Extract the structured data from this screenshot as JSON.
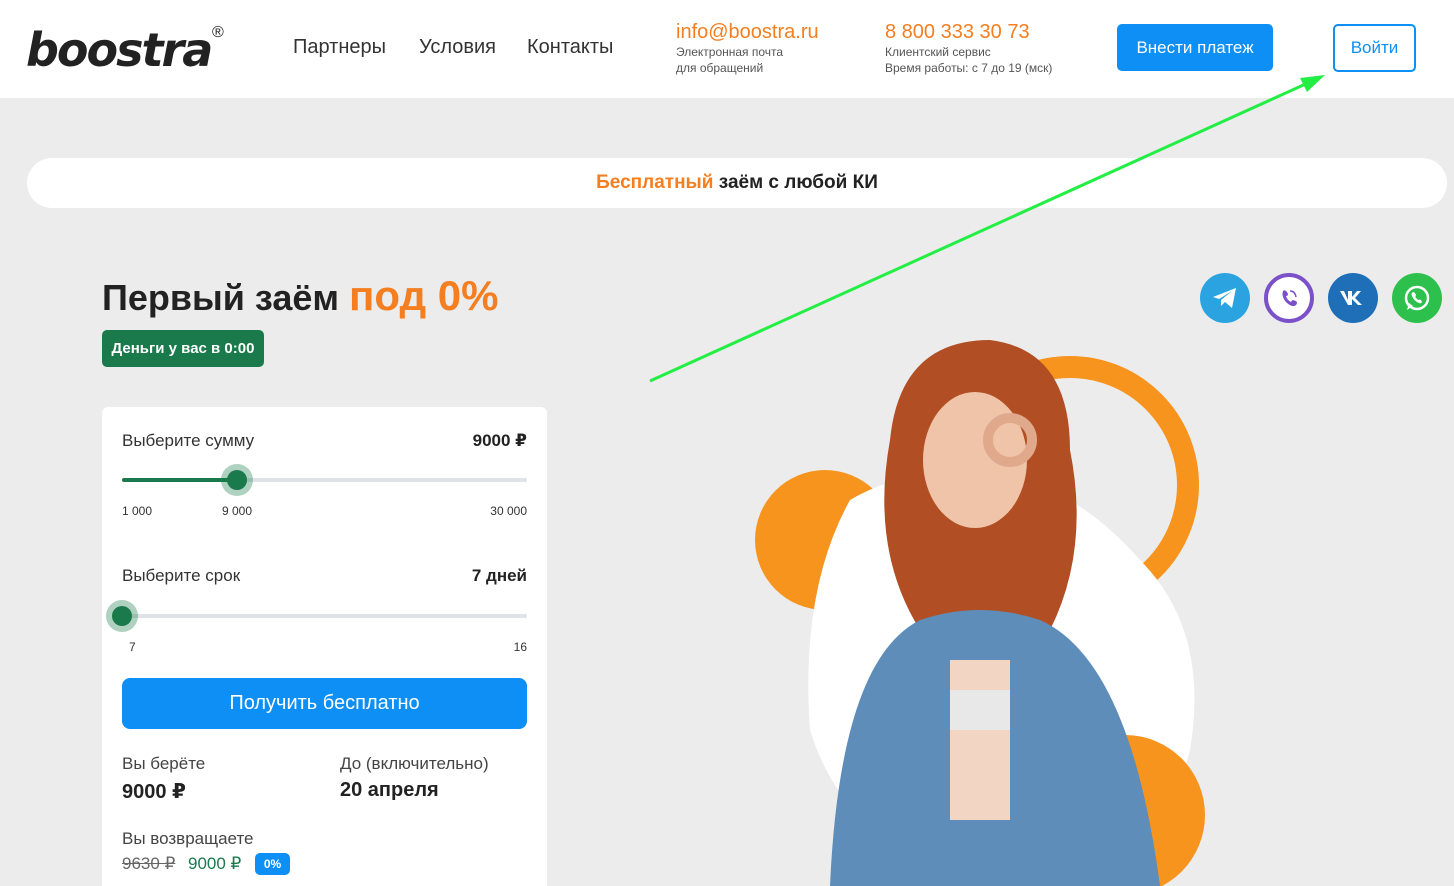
{
  "header": {
    "logo": "boostra",
    "logo_mark": "®",
    "nav": [
      "Партнеры",
      "Условия",
      "Контакты"
    ],
    "email": "info@boostra.ru",
    "email_caption_1": "Электронная почта",
    "email_caption_2": "для обращений",
    "phone": "8 800 333 30 73",
    "phone_caption_1": "Клиентский сервис",
    "phone_caption_2": "Время работы: с 7 до 19 (мск)",
    "pay_button": "Внести платеж",
    "login_button": "Войти"
  },
  "promo": {
    "accent": "Бесплатный",
    "rest": " заём с любой КИ"
  },
  "hero": {
    "title": "Первый заём ",
    "title_accent": "под 0%",
    "badge": "Деньги у вас в 0:00"
  },
  "calculator": {
    "amount": {
      "label": "Выберите сумму",
      "value": "9000 ₽",
      "min_label": "1 000",
      "current_label": "9 000",
      "max_label": "30 000",
      "min": 1000,
      "max": 30000,
      "current": 9000
    },
    "term": {
      "label": "Выберите срок",
      "value": "7 дней",
      "min_label": "7",
      "max_label": "16",
      "min": 7,
      "max": 16,
      "current": 7
    },
    "submit": "Получить бесплатно",
    "take_label": "Вы берёте",
    "take_value": "9000 ₽",
    "until_label": "До (включительно)",
    "until_value": "20 апреля",
    "return_label": "Вы возвращаете",
    "old_price": "9630 ₽",
    "new_price": "9000 ₽",
    "zero_badge": "0%"
  },
  "social": [
    "telegram-icon",
    "viber-icon",
    "vk-icon",
    "whatsapp-icon"
  ],
  "colors": {
    "accent": "#f47e20",
    "primary": "#0d8ff5",
    "green": "#1a7a4b",
    "annotation_arrow": "#22ee44"
  }
}
